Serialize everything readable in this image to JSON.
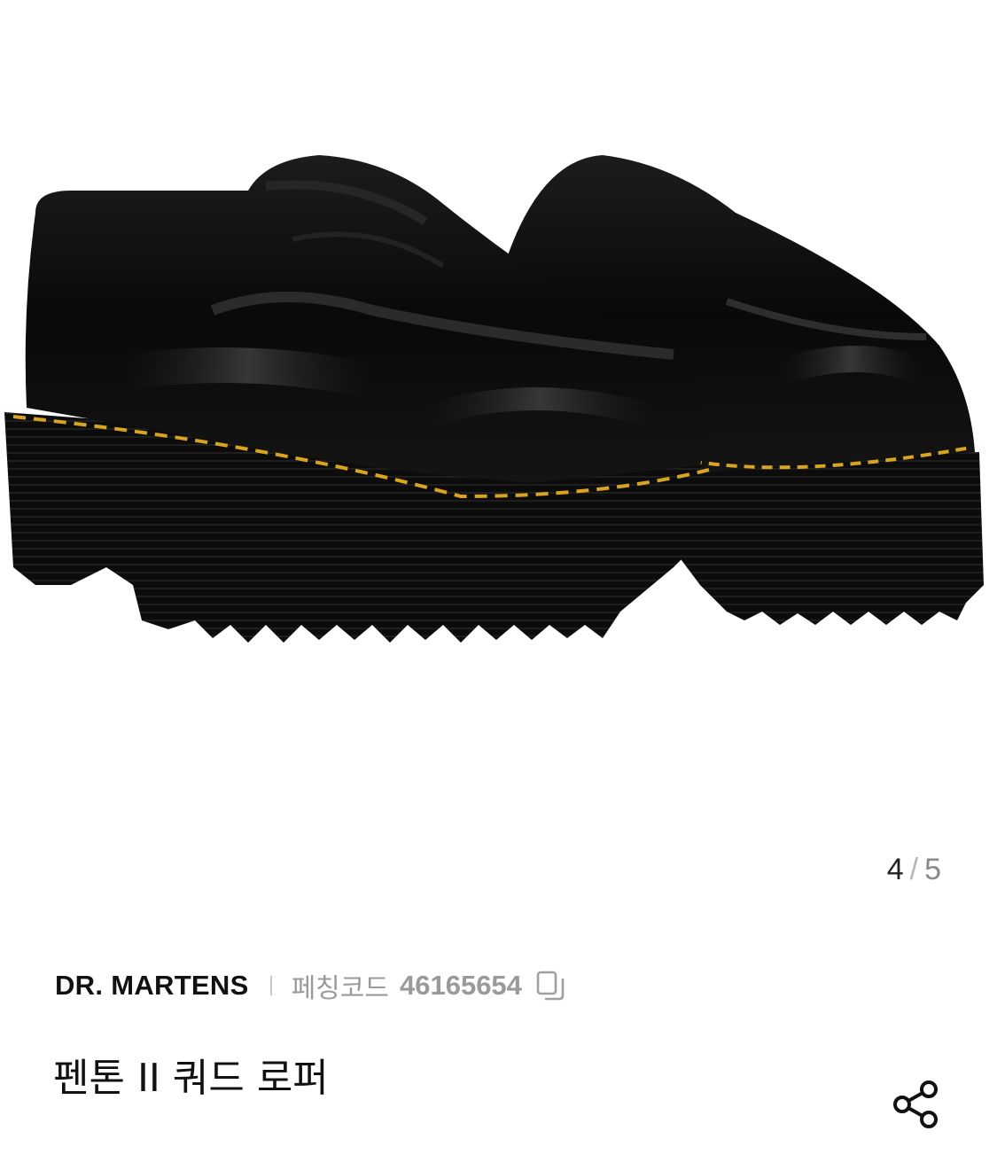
{
  "gallery": {
    "image_alt": "Black platform penny loafers with yellow stitching",
    "current_page": "4",
    "separator": "/",
    "total_pages": "5"
  },
  "product": {
    "brand": "DR. MARTENS",
    "code_label": "페칭코드",
    "code_value": "46165654",
    "title": "펜톤 II 쿼드 로퍼"
  },
  "icons": {
    "copy": "copy-icon",
    "share": "share-icon"
  },
  "colors": {
    "stitch": "#d9a521",
    "shoe": "#0d0d0d",
    "muted_text": "#9a9a9a"
  }
}
